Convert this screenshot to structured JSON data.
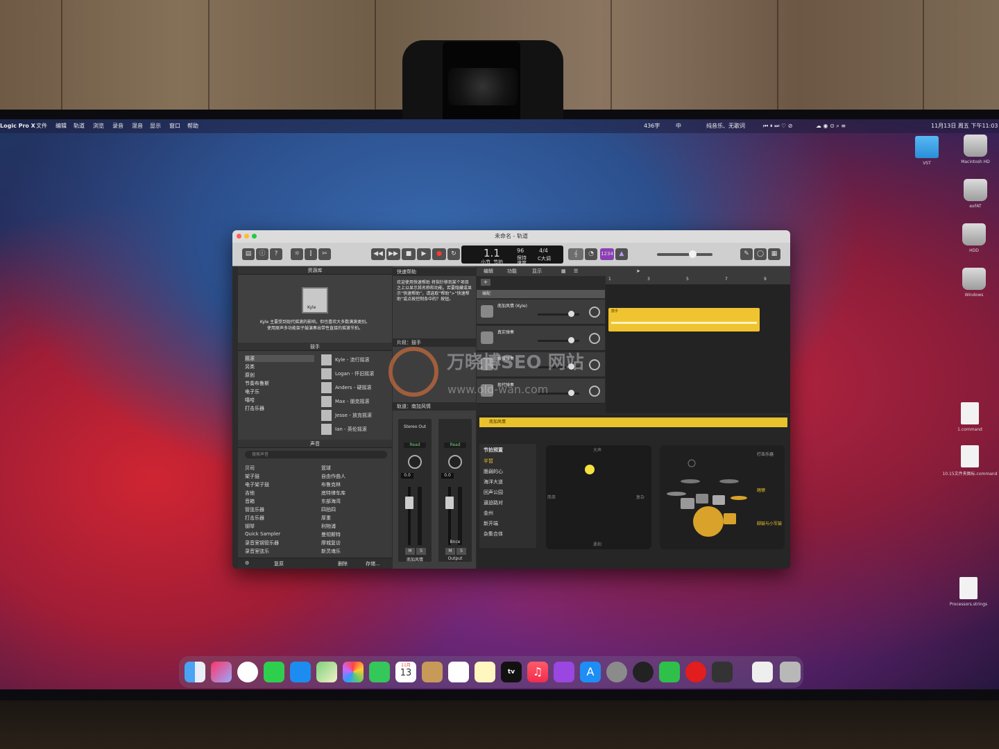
{
  "menubar": {
    "app": "Logic Pro X",
    "file": "文件",
    "edit": "编辑",
    "track": "轨道",
    "navigate": "浏览",
    "record": "录音",
    "mix": "混音",
    "view": "显示",
    "window": "窗口",
    "help": "帮助",
    "status_chars": "436字",
    "input": "中",
    "now_playing": "纯音乐、无歌词",
    "clock": "11月13日 周五 下午11:03"
  },
  "desktop": {
    "items": [
      {
        "label": "VST",
        "kind": "folder"
      },
      {
        "label": "Macintosh HD",
        "kind": "hdd"
      },
      {
        "label": "exFAT",
        "kind": "hdd"
      },
      {
        "label": "HDD",
        "kind": "hdd"
      },
      {
        "label": "Windows",
        "kind": "hdd"
      },
      {
        "label": "1.command",
        "kind": "doc"
      },
      {
        "label": "10.15文件夹图标.command",
        "kind": "doc"
      },
      {
        "label": "Processors.strings",
        "kind": "doc"
      }
    ]
  },
  "window": {
    "title": "未命名 - 轨道"
  },
  "lcd": {
    "position": "1.1",
    "bar": "小节",
    "beat": "节拍",
    "tempo": "96",
    "tempo_label": "保持",
    "tempo_sub": "速度",
    "signature": "4/4",
    "key": "C大调"
  },
  "toolbar": {
    "count_in": "1234"
  },
  "library": {
    "title": "资源库",
    "drummer_name": "Kyle",
    "desc": "Kyle 主要受到现代摇滚的影响，但也喜欢大多数满滚类别。使用原声多功能架子鼓演奏出带性直接的摇滚节拍。",
    "drummer_header": "鼓手",
    "genres": [
      "摇滚",
      "另类",
      "原创",
      "节奏布鲁斯",
      "电子乐",
      "嘻哈",
      "打击乐器"
    ],
    "drummers": [
      "Kyle - 流行摇滚",
      "Logan - 怀旧摇滚",
      "Anders - 硬摇滚",
      "Max - 朋克摇滚",
      "Jesse - 放克摇滚",
      "Ian - 英伦摇滚"
    ],
    "sounds_header": "声音",
    "search_placeholder": "搜索声音",
    "sound_cats": [
      "贝司",
      "架子鼓",
      "电子架子鼓",
      "吉他",
      "音箱",
      "管弦乐器",
      "打击乐器",
      "钢琴",
      "Quick Sampler",
      "录音室钢管乐器",
      "录音室弦乐"
    ],
    "sound_items": [
      "篮球",
      "自由作曲人",
      "布鲁克林",
      "底特律车库",
      "东部海湾",
      "四拍四",
      "厚重",
      "利物浦",
      "曼彻斯特",
      "摩城复访",
      "新灵魂乐"
    ],
    "footer": {
      "revert": "复原",
      "delete": "删除",
      "save": "存储..."
    }
  },
  "help": {
    "title": "快速帮助",
    "text": "欢迎使用快速帮助\n将指针移到某个项目之上以显示其名称和功能。若要隐藏或显示“快速帮助”，请选取“帮助”>“快速帮助”或点按控制条中的？按钮。",
    "region_header": "片段：鼓手",
    "track_header": "轨道：南加风情",
    "strip1": {
      "name": "南加风情",
      "out": "Stereo Out",
      "read": "Read",
      "val": "0.0",
      "m": "M",
      "s": "S"
    },
    "strip2": {
      "name": "Output",
      "bnce": "Bnce",
      "read": "Read",
      "val": "0.0",
      "m": "M",
      "s": "S"
    }
  },
  "tracks": {
    "menu": [
      "编辑",
      "功能",
      "显示"
    ],
    "folder": "编配",
    "ruler": [
      "1",
      "3",
      "5",
      "7",
      "9"
    ],
    "heads": [
      "南加风情 (Kyle)",
      "真实弹奏",
      "拨弦弹奏",
      "现代弹奏"
    ],
    "region": "鼓手"
  },
  "editor": {
    "header": "南加风情",
    "presets_title": "节拍预置",
    "presets": [
      "半暂",
      "脆弱的心",
      "海洋大道",
      "回声公园",
      "逼迫路对",
      "金州",
      "新开端",
      "杂集合体"
    ],
    "xy_top": "大声",
    "xy_bottom": "柔和",
    "xy_left": "简单",
    "xy_right": "复杂",
    "kit_label1": "打击乐器",
    "kit_label2": "踏镲",
    "kit_label3": "脚鼓与小军鼓"
  },
  "dock": {
    "calendar_month": "11月",
    "calendar_day": "13",
    "tv": "tv"
  }
}
